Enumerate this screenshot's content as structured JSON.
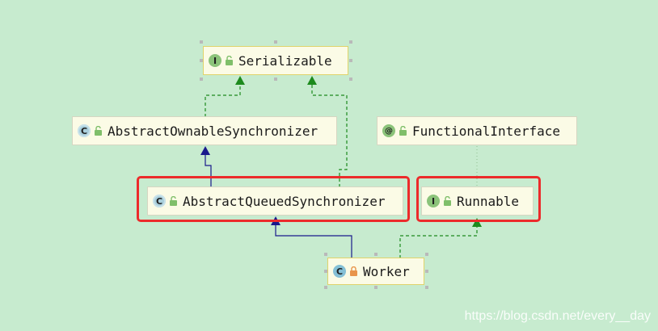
{
  "nodes": {
    "serializable": {
      "label": "Serializable",
      "badge": "I",
      "kind": "interface"
    },
    "abstract_ownable_synchronizer": {
      "label": "AbstractOwnableSynchronizer",
      "badge": "C",
      "kind": "abstract-class"
    },
    "functional_interface": {
      "label": "FunctionalInterface",
      "badge": "@",
      "kind": "annotation"
    },
    "abstract_queued_synchronizer": {
      "label": "AbstractQueuedSynchronizer",
      "badge": "C",
      "kind": "abstract-class"
    },
    "runnable": {
      "label": "Runnable",
      "badge": "I",
      "kind": "interface"
    },
    "worker": {
      "label": "Worker",
      "badge": "C",
      "kind": "class"
    }
  },
  "edges": [
    {
      "from": "abstract_ownable_synchronizer",
      "to": "serializable",
      "type": "implements",
      "color": "#1d8a1d"
    },
    {
      "from": "abstract_queued_synchronizer",
      "to": "serializable",
      "type": "implements",
      "color": "#1d8a1d"
    },
    {
      "from": "abstract_queued_synchronizer",
      "to": "abstract_ownable_synchronizer",
      "type": "extends",
      "color": "#1a1a8c"
    },
    {
      "from": "worker",
      "to": "abstract_queued_synchronizer",
      "type": "extends",
      "color": "#1a1a8c"
    },
    {
      "from": "worker",
      "to": "runnable",
      "type": "implements",
      "color": "#1d8a1d"
    },
    {
      "from": "runnable",
      "to": "functional_interface",
      "type": "annotated-by",
      "color": "#8fbf8f"
    }
  ],
  "colors": {
    "background": "#c7ebcf",
    "highlight": "#ec2b2b",
    "implements": "#1d8a1d",
    "extends": "#1a1a8c"
  },
  "watermark": "https://blog.csdn.net/every__day"
}
